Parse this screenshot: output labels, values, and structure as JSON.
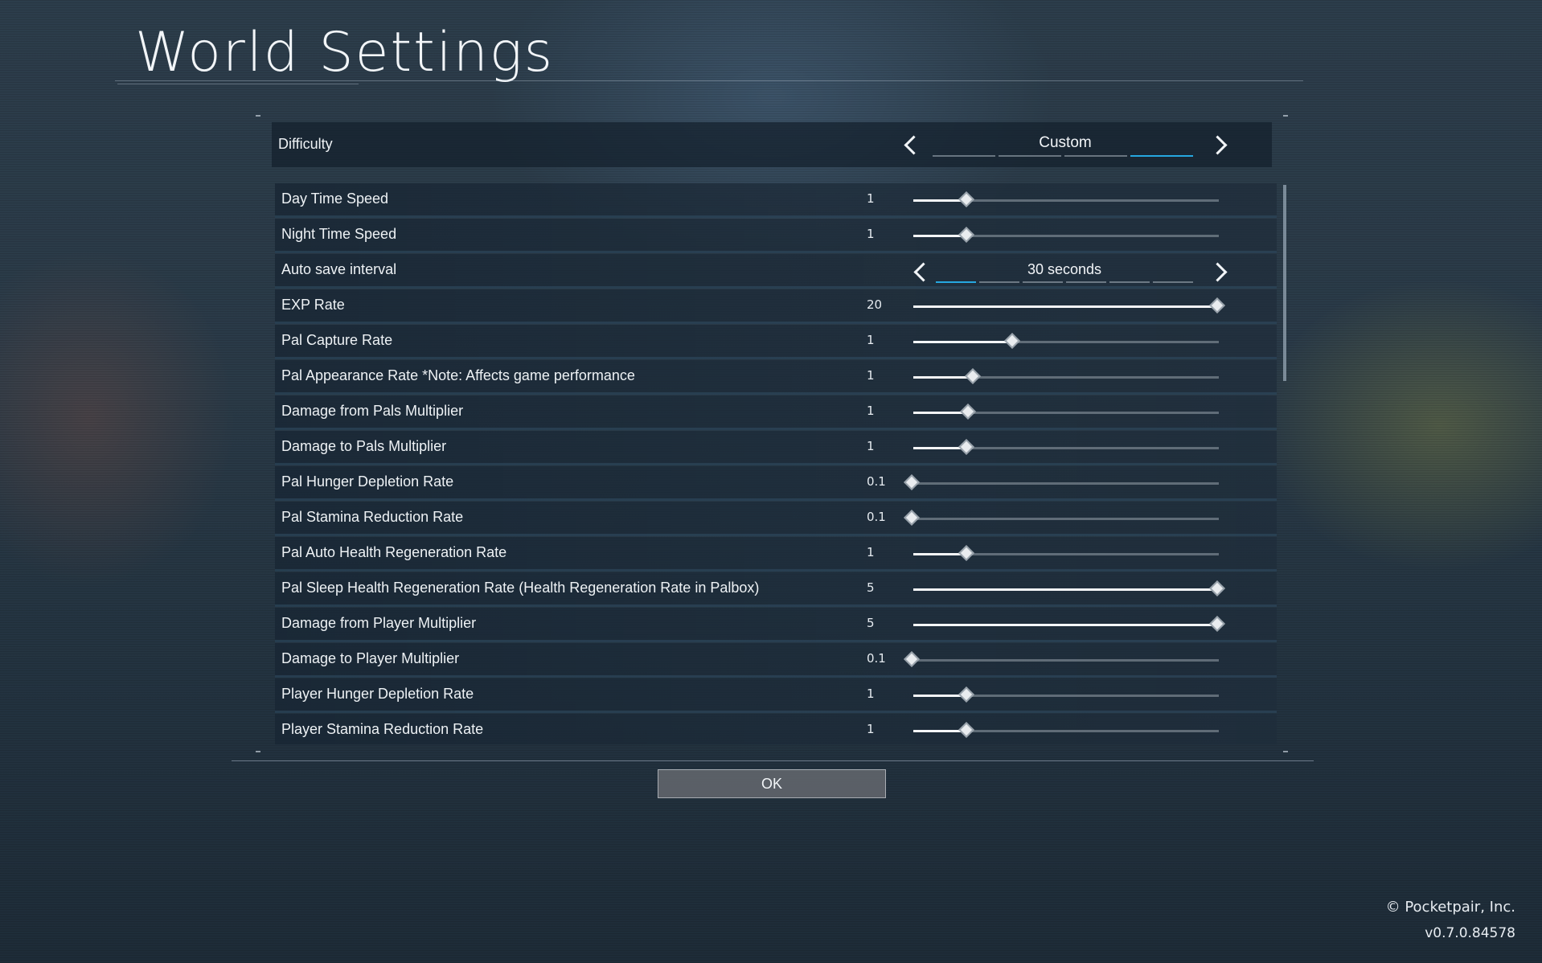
{
  "page": {
    "title": "World Settings",
    "ok_label": "OK",
    "copyright": "© Pocketpair, Inc.",
    "version": "v0.7.0.84578"
  },
  "difficulty": {
    "label": "Difficulty",
    "value": "Custom",
    "segment_count": 4,
    "active_segment": 4
  },
  "settings": [
    {
      "label": "Day Time Speed",
      "value": "1",
      "fraction": 0.18
    },
    {
      "label": "Night Time Speed",
      "value": "1",
      "fraction": 0.18
    },
    {
      "label": "Auto save interval",
      "type": "selector",
      "value": "30 seconds",
      "segment_count": 6,
      "active_segment": 1
    },
    {
      "label": "EXP Rate",
      "value": "20",
      "fraction": 1.0
    },
    {
      "label": "Pal Capture Rate",
      "value": "1",
      "fraction": 0.33
    },
    {
      "label": "Pal Appearance Rate *Note: Affects game performance",
      "value": "1",
      "fraction": 0.2
    },
    {
      "label": "Damage from Pals Multiplier",
      "value": "1",
      "fraction": 0.185
    },
    {
      "label": "Damage to Pals Multiplier",
      "value": "1",
      "fraction": 0.18
    },
    {
      "label": "Pal Hunger Depletion Rate",
      "value": "0.1",
      "fraction": 0.0
    },
    {
      "label": "Pal Stamina Reduction Rate",
      "value": "0.1",
      "fraction": 0.0
    },
    {
      "label": "Pal Auto Health Regeneration Rate",
      "value": "1",
      "fraction": 0.18
    },
    {
      "label": "Pal Sleep Health Regeneration Rate (Health Regeneration Rate in Palbox)",
      "value": "5",
      "fraction": 1.0
    },
    {
      "label": "Damage from Player Multiplier",
      "value": "5",
      "fraction": 1.0
    },
    {
      "label": "Damage to Player Multiplier",
      "value": "0.1",
      "fraction": 0.0
    },
    {
      "label": "Player Hunger Depletion Rate",
      "value": "1",
      "fraction": 0.18
    },
    {
      "label": "Player Stamina Reduction Rate",
      "value": "1",
      "fraction": 0.18
    }
  ],
  "colors": {
    "accent": "#26a8e0",
    "button_bg": "#5f646a",
    "panel_bg": "#18263a"
  }
}
